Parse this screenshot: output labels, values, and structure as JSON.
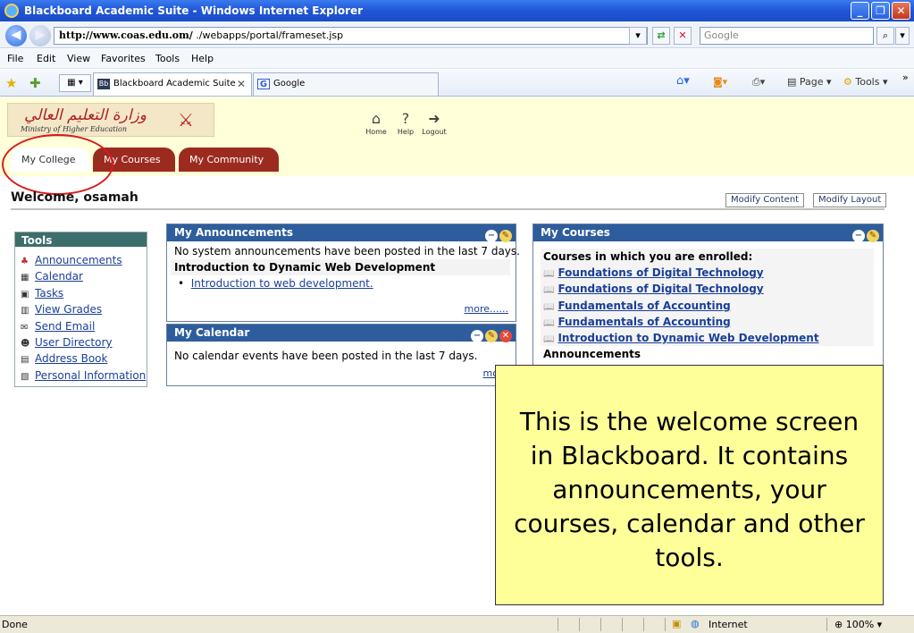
{
  "window": {
    "title": "Blackboard Academic Suite - Windows Internet Explorer",
    "minimize": "_",
    "maximize": "❐",
    "close": "✕"
  },
  "address": {
    "url_bold": "http://www.coas.edu.om/",
    "url_rest": "./webapps/portal/frameset.jsp",
    "search_placeholder": "Google"
  },
  "menu": [
    "File",
    "Edit",
    "View",
    "Favorites",
    "Tools",
    "Help"
  ],
  "browser_tabs": [
    {
      "label": "Blackboard Academic Suite",
      "icon": "Bb"
    },
    {
      "label": "Google",
      "icon": "G"
    }
  ],
  "commands": {
    "page": "Page ▾",
    "tools": "Tools ▾"
  },
  "logo": {
    "arabic": "وزارة التعليم العالي",
    "english": "Ministry of Higher Education"
  },
  "topnav": [
    {
      "label": "Home",
      "icon": "home-icon"
    },
    {
      "label": "Help",
      "icon": "help-icon"
    },
    {
      "label": "Logout",
      "icon": "logout-icon"
    }
  ],
  "portal_tabs": [
    "My College",
    "My Courses",
    "My Community"
  ],
  "welcome": "Welcome, osamah",
  "buttons": {
    "modify_content": "Modify Content",
    "modify_layout": "Modify Layout"
  },
  "tools": {
    "title": "Tools",
    "items": [
      "Announcements",
      "Calendar",
      "Tasks",
      "View Grades",
      "Send Email",
      "User Directory",
      "Address Book",
      "Personal Information"
    ]
  },
  "announcements": {
    "title": "My Announcements",
    "system_text": "No system announcements have been posted in the last 7 days.",
    "course": "Introduction to Dynamic Web Development",
    "item": "Introduction to web development.",
    "more": "more......"
  },
  "calendar": {
    "title": "My Calendar",
    "text": "No calendar events have been posted in the last 7 days.",
    "more": "more"
  },
  "courses": {
    "title": "My Courses",
    "heading": "Courses in which you are enrolled:",
    "items": [
      "Foundations of Digital Technology",
      "Foundations of Digital Technology",
      "Fundamentals of Accounting",
      "Fundamentals of Accounting",
      "Introduction to Dynamic Web Development"
    ],
    "announcements_label": "Announcements"
  },
  "callout": "This is the welcome screen in Blackboard.  It contains announcements, your courses, calendar and other tools.",
  "status": {
    "left": "Done",
    "zone": "Internet",
    "zoom": "100%"
  },
  "colors": {
    "accent_tab": "#9c2b1f",
    "portlet_header": "#2d5d9c",
    "tools_header": "#3c6e6b",
    "header_bg": "#ffffd9",
    "callout_bg": "#ffff99",
    "annotation": "#d81c1c"
  }
}
